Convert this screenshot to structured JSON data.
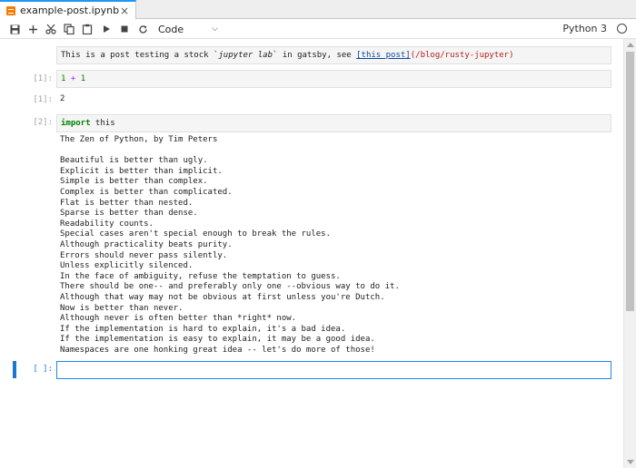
{
  "tab": {
    "title": "example-post.ipynb",
    "close_glyph": "×"
  },
  "toolbar": {
    "buttons": [
      {
        "name": "save",
        "icon": "save-icon"
      },
      {
        "name": "insert-cell",
        "icon": "plus-icon"
      },
      {
        "name": "cut",
        "icon": "scissors-icon"
      },
      {
        "name": "copy",
        "icon": "copy-icon"
      },
      {
        "name": "paste",
        "icon": "paste-icon"
      },
      {
        "name": "run",
        "icon": "play-icon"
      },
      {
        "name": "interrupt",
        "icon": "stop-icon"
      },
      {
        "name": "restart",
        "icon": "refresh-icon"
      }
    ],
    "cell_type": "Code",
    "kernel_name": "Python 3",
    "kernel_status_icon": "circle-icon"
  },
  "cells": {
    "markdown": {
      "text_before": "This is a post testing a stock `",
      "code_text": "jupyter lab",
      "text_mid": "` in gatsby, see ",
      "link_text": "[this post]",
      "link_url": "(/blog/rusty-jupyter)"
    },
    "cell1": {
      "in_prompt": "[1]:",
      "code_num1": "1",
      "code_op": " + ",
      "code_num2": "1",
      "out_prompt": "[1]:",
      "output": "2"
    },
    "cell2": {
      "in_prompt": "[2]:",
      "code_kw": "import",
      "code_rest": " this",
      "output": "The Zen of Python, by Tim Peters\n\nBeautiful is better than ugly.\nExplicit is better than implicit.\nSimple is better than complex.\nComplex is better than complicated.\nFlat is better than nested.\nSparse is better than dense.\nReadability counts.\nSpecial cases aren't special enough to break the rules.\nAlthough practicality beats purity.\nErrors should never pass silently.\nUnless explicitly silenced.\nIn the face of ambiguity, refuse the temptation to guess.\nThere should be one-- and preferably only one --obvious way to do it.\nAlthough that way may not be obvious at first unless you're Dutch.\nNow is better than never.\nAlthough never is often better than *right* now.\nIf the implementation is hard to explain, it's a bad idea.\nIf the implementation is easy to explain, it may be a good idea.\nNamespaces are one honking great idea -- let's do more of those!"
    },
    "cell3": {
      "in_prompt": "[ ]:",
      "code": ""
    }
  },
  "colors": {
    "accent": "#1976d2",
    "active_border": "#1e88e5",
    "notebook_icon": "#f57c00",
    "keyword": "#008000",
    "operator": "#aa22ff",
    "link": "#0d47a1",
    "url": "#b71c1c"
  }
}
